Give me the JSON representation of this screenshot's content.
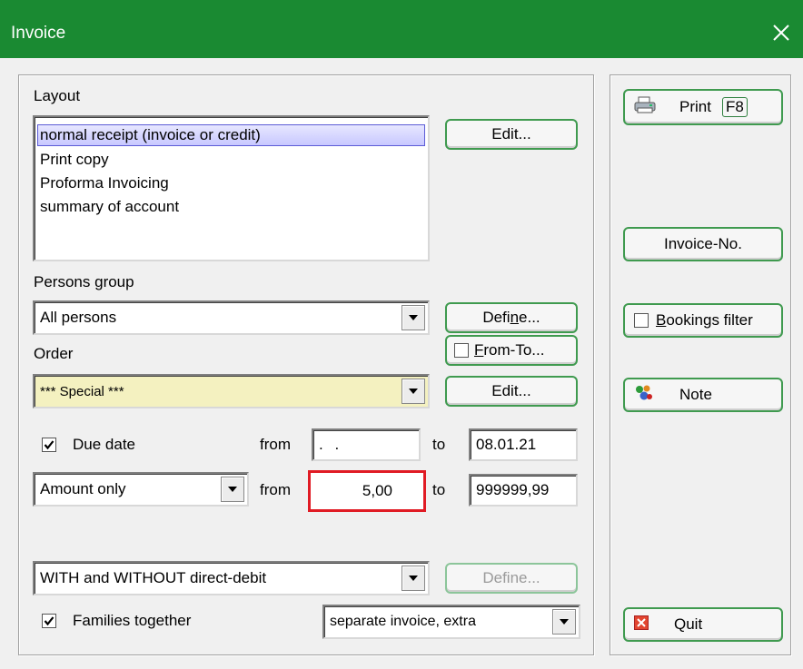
{
  "window": {
    "title": "Invoice"
  },
  "layout": {
    "label": "Layout",
    "items": [
      "normal receipt (invoice or credit)",
      "Print copy",
      "Proforma Invoicing",
      "summary of account"
    ],
    "edit_button": "Edit..."
  },
  "persons_group": {
    "label_pre": "Persons ",
    "label_mn": "g",
    "label_post": "roup",
    "value": "All persons",
    "define_pre": "Defi",
    "define_mn": "n",
    "define_post": "e..."
  },
  "order": {
    "label": "Order",
    "from_to_mn": "F",
    "from_to_post": "rom-To...",
    "from_to_checked": false,
    "value": "*** Special ***",
    "edit_button": "Edit..."
  },
  "due_date": {
    "label": "Due date",
    "checked": true,
    "from_label": "from",
    "from_value": ". .",
    "to_label": "to",
    "to_value": "08.01.21"
  },
  "amount": {
    "mode": "Amount only",
    "from_label": "from",
    "from_value": "5,00",
    "to_label": "to",
    "to_value": "999999,99"
  },
  "direct_debit": {
    "value": "WITH and WITHOUT direct-debit",
    "define_button": "Define..."
  },
  "families": {
    "label": "Families together",
    "checked": true,
    "mode": "separate invoice, extra"
  },
  "side": {
    "print_label": "Print",
    "print_key": "F8",
    "invoice_no": "Invoice-No.",
    "bookings_filter_mn": "B",
    "bookings_filter_post": "ookings filter",
    "bookings_filter_checked": false,
    "note": "Note",
    "quit": "Quit"
  },
  "colors": {
    "title_bar": "#1a8a32",
    "button_border": "#3f9a4f",
    "highlight": "#e01b24",
    "order_field": "#f4f1c0"
  }
}
